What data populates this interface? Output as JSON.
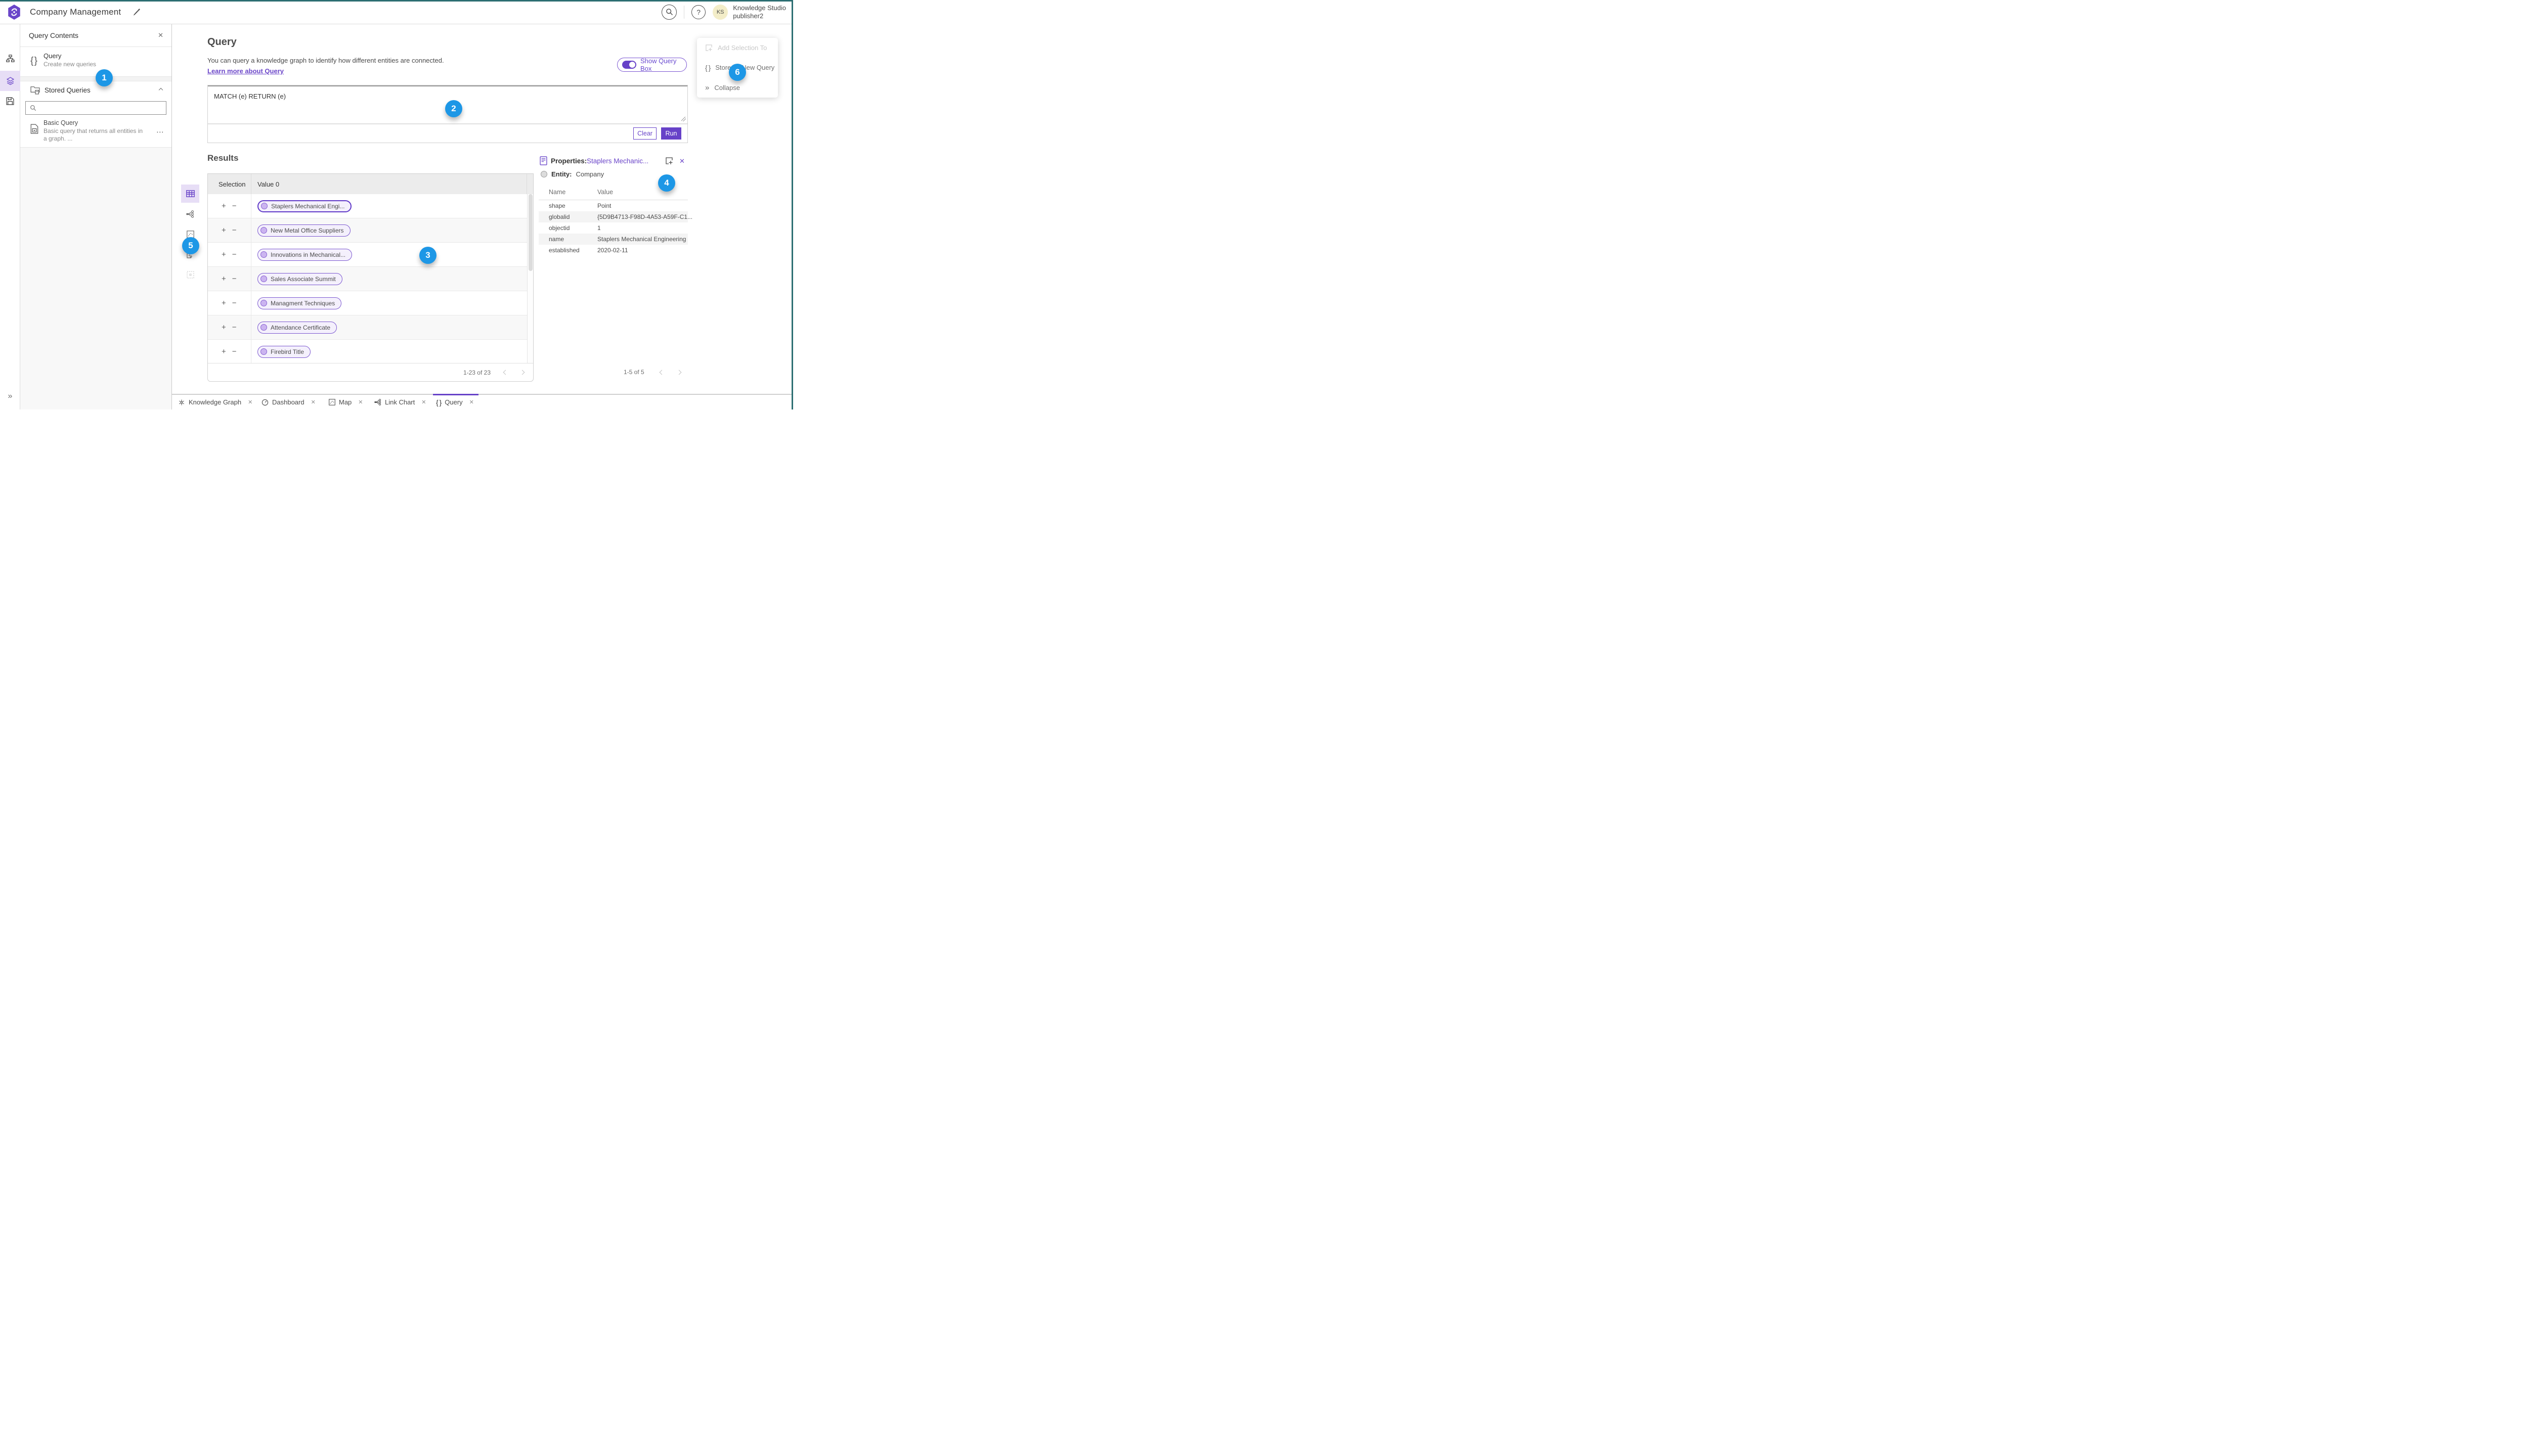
{
  "icons": {
    "close": "✕",
    "ellipsis": "⋯",
    "plus": "+",
    "minus": "−",
    "braces": "{ }",
    "collapse_rail": "»",
    "help": "?"
  },
  "header": {
    "app_title": "Company Management",
    "user_name": "Knowledge Studio",
    "user_role": "publisher2",
    "avatar_initials": "KS"
  },
  "sidebar": {
    "title": "Query Contents",
    "query_item": {
      "title": "Query",
      "subtitle": "Create new queries"
    },
    "stored_section_title": "Stored Queries",
    "search_placeholder": "",
    "stored_item": {
      "title": "Basic Query",
      "description": "Basic query that returns all entities in a graph. ..."
    }
  },
  "query_section": {
    "title": "Query",
    "description": "You can query a knowledge graph to identify how different entities are connected.",
    "learn_more": "Learn more about Query",
    "show_query_box": "Show Query Box",
    "query_text": "MATCH (e) RETURN (e)",
    "clear_label": "Clear",
    "run_label": "Run"
  },
  "results": {
    "title": "Results",
    "col_selection": "Selection",
    "col_value": "Value 0",
    "rows": [
      {
        "label": "Staplers Mechanical Engi..."
      },
      {
        "label": "New Metal Office Suppliers"
      },
      {
        "label": "Innovations in Mechanical..."
      },
      {
        "label": "Sales Associate Summit"
      },
      {
        "label": "Managment Techniques"
      },
      {
        "label": "Attendance Certificate"
      },
      {
        "label": "Firebird Title"
      }
    ],
    "pagination": "1-23 of 23"
  },
  "properties": {
    "label": "Properties:",
    "entity_link": "Staplers Mechanic...",
    "entity_label": "Entity:",
    "entity_type": "Company",
    "col_name": "Name",
    "col_value": "Value",
    "rows": [
      {
        "name": "shape",
        "value": "Point"
      },
      {
        "name": "globalid",
        "value": "{5D9B4713-F98D-4A53-A59F-C1..."
      },
      {
        "name": "objectid",
        "value": "1"
      },
      {
        "name": "name",
        "value": "Staplers Mechanical Engineering"
      },
      {
        "name": "established",
        "value": "2020-02-11"
      }
    ],
    "pagination": "1-5 of 5"
  },
  "context_menu": {
    "items": [
      {
        "label": "Add Selection To"
      },
      {
        "label": "Store as New Query"
      },
      {
        "label": "Collapse"
      }
    ]
  },
  "tabs": [
    {
      "label": "Knowledge Graph"
    },
    {
      "label": "Dashboard"
    },
    {
      "label": "Map"
    },
    {
      "label": "Link Chart"
    },
    {
      "label": "Query"
    }
  ],
  "badges": [
    {
      "number": "1"
    },
    {
      "number": "2"
    },
    {
      "number": "3"
    },
    {
      "number": "4"
    },
    {
      "number": "5"
    },
    {
      "number": "6"
    }
  ],
  "colors": {
    "accent_purple": "#6742c8",
    "badge_blue": "#1d97e6",
    "edge_teal": "#2c6e72"
  }
}
